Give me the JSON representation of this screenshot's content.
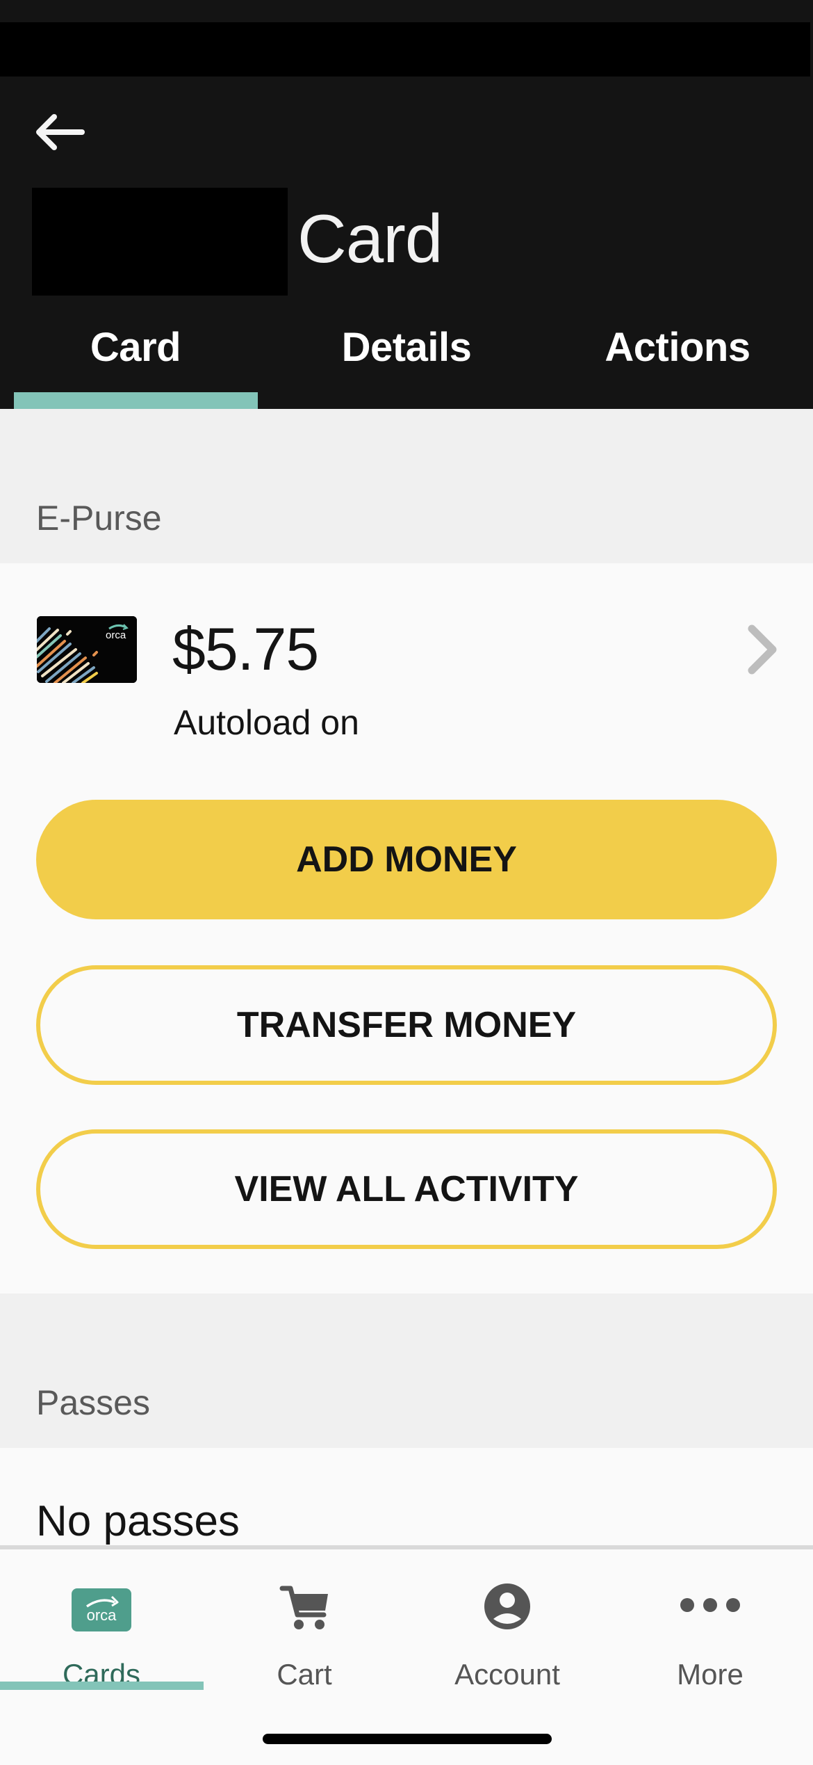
{
  "header": {
    "title_suffix": "Card",
    "back_icon": "arrow-left-icon",
    "tabs": [
      {
        "label": "Card",
        "active": true
      },
      {
        "label": "Details",
        "active": false
      },
      {
        "label": "Actions",
        "active": false
      }
    ]
  },
  "epurse": {
    "section_title": "E-Purse",
    "card_logo_text": "orca",
    "balance": "$5.75",
    "autoload_status": "Autoload on",
    "chevron_icon": "chevron-right-icon",
    "buttons": {
      "add_money": "ADD MONEY",
      "transfer_money": "TRANSFER MONEY",
      "view_all_activity": "VIEW ALL ACTIVITY"
    }
  },
  "passes": {
    "section_title": "Passes",
    "empty_text": "No passes"
  },
  "bottom_nav": {
    "items": [
      {
        "label": "Cards",
        "icon": "orca-card-icon",
        "active": true
      },
      {
        "label": "Cart",
        "icon": "cart-icon",
        "active": false
      },
      {
        "label": "Account",
        "icon": "account-circle-icon",
        "active": false
      },
      {
        "label": "More",
        "icon": "more-horizontal-icon",
        "active": false
      }
    ]
  },
  "colors": {
    "header_bg": "#141414",
    "accent_teal": "#83c4b8",
    "orca_green": "#4f9e8c",
    "button_yellow": "#f2cd4a",
    "section_gray": "#f0f0f0"
  }
}
